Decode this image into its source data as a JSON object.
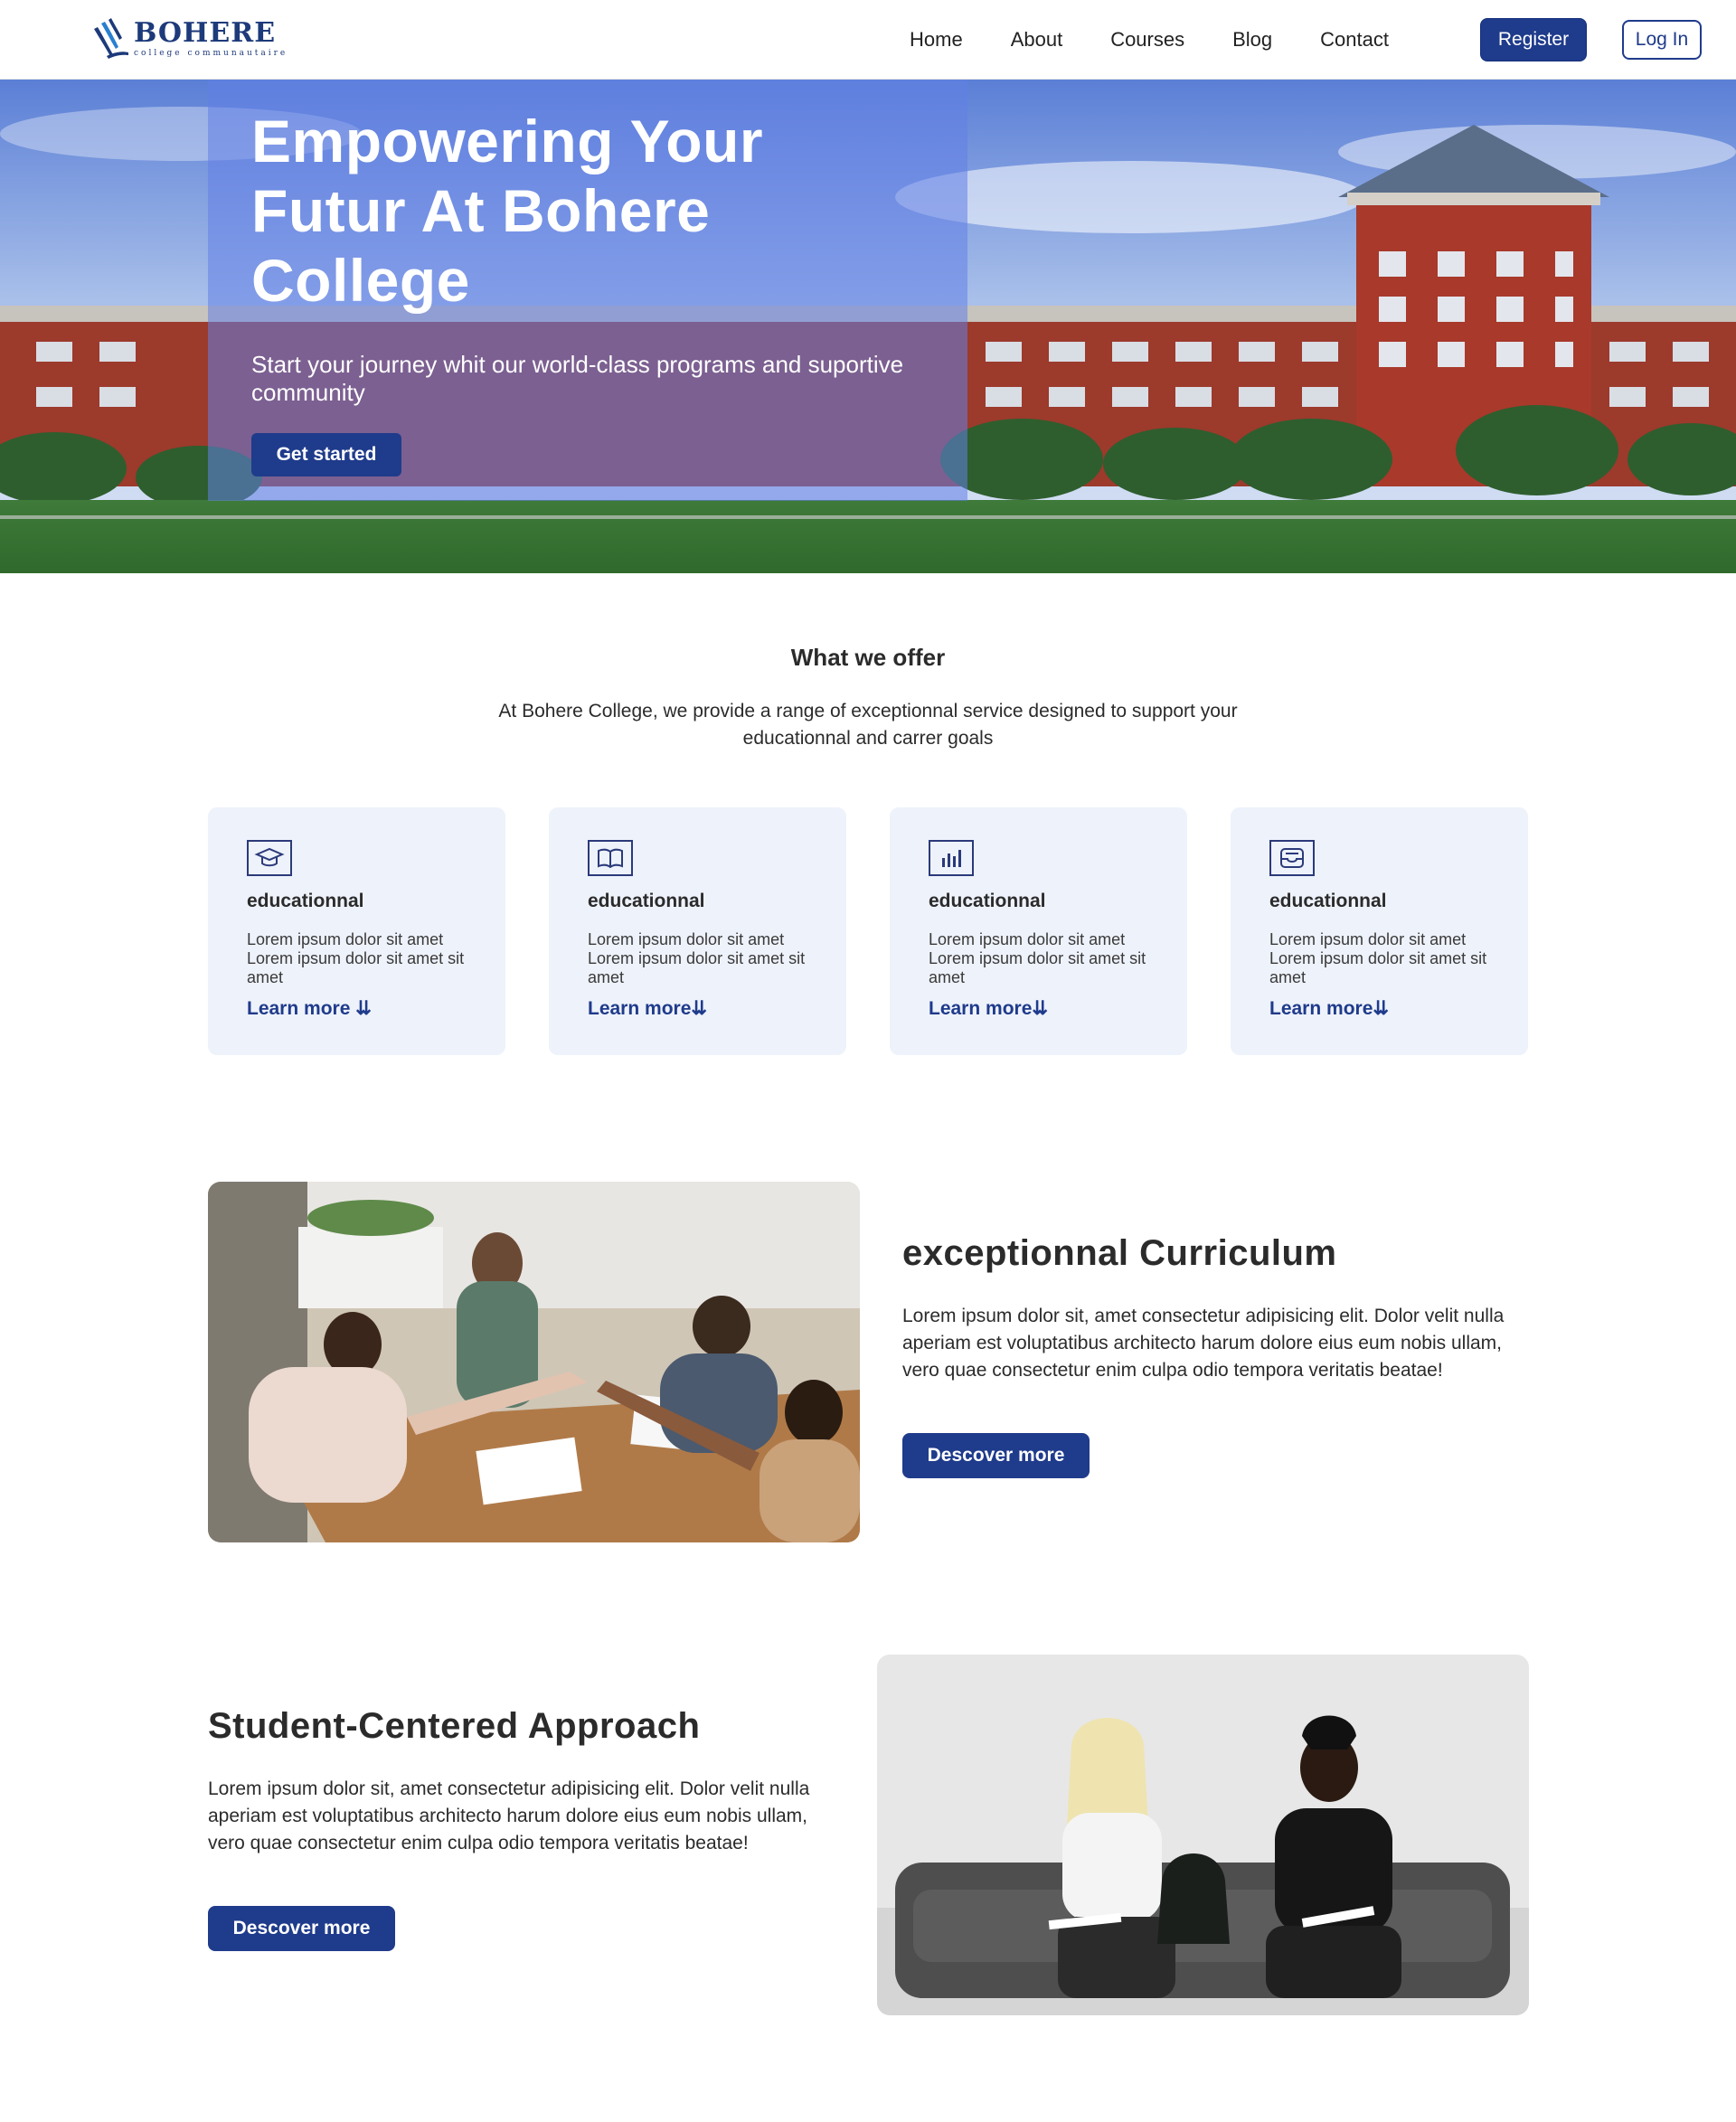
{
  "brand": {
    "name": "BOHERE",
    "tagline": "college communautaire",
    "primary_color": "#1f3b8b"
  },
  "nav": {
    "links": [
      "Home",
      "About",
      "Courses",
      "Blog",
      "Contact"
    ],
    "register_label": "Register",
    "login_label": "Log In"
  },
  "hero": {
    "title": "Empowering Your Futur At Bohere College",
    "subtitle": "Start your journey whit our world-class programs and suportive community",
    "cta_label": "Get started"
  },
  "offer": {
    "title": "What we offer",
    "description": "At Bohere College, we provide a range of exceptionnal service designed to support your educationnal and carrer goals",
    "cards": [
      {
        "icon": "graduation-cap-icon",
        "title": "educationnal",
        "text": "Lorem ipsum dolor sit amet Lorem ipsum dolor sit amet sit amet",
        "link": "Learn more ⇊"
      },
      {
        "icon": "book-open-icon",
        "title": "educationnal",
        "text": "Lorem ipsum dolor sit amet Lorem ipsum dolor sit amet sit amet",
        "link": "Learn more⇊"
      },
      {
        "icon": "bar-chart-icon",
        "title": "educationnal",
        "text": "Lorem ipsum dolor sit amet Lorem ipsum dolor sit amet sit amet",
        "link": "Learn more⇊"
      },
      {
        "icon": "inbox-icon",
        "title": "educationnal",
        "text": "Lorem ipsum dolor sit amet Lorem ipsum dolor sit amet sit amet",
        "link": "Learn more⇊"
      }
    ]
  },
  "features": [
    {
      "title": "exceptionnal Curriculum",
      "text": "Lorem ipsum dolor sit, amet consectetur adipisicing elit. Dolor velit nulla aperiam est voluptatibus architecto harum dolore eius eum nobis ullam, vero quae consectetur enim culpa odio tempora veritatis beatae!",
      "cta_label": "Descover more"
    },
    {
      "title": "Student-Centered Approach",
      "text": "Lorem ipsum dolor sit, amet consectetur adipisicing elit. Dolor velit nulla aperiam est voluptatibus architecto harum dolore eius eum nobis ullam, vero quae consectetur enim culpa odio tempora veritatis beatae!",
      "cta_label": "Descover more"
    }
  ]
}
